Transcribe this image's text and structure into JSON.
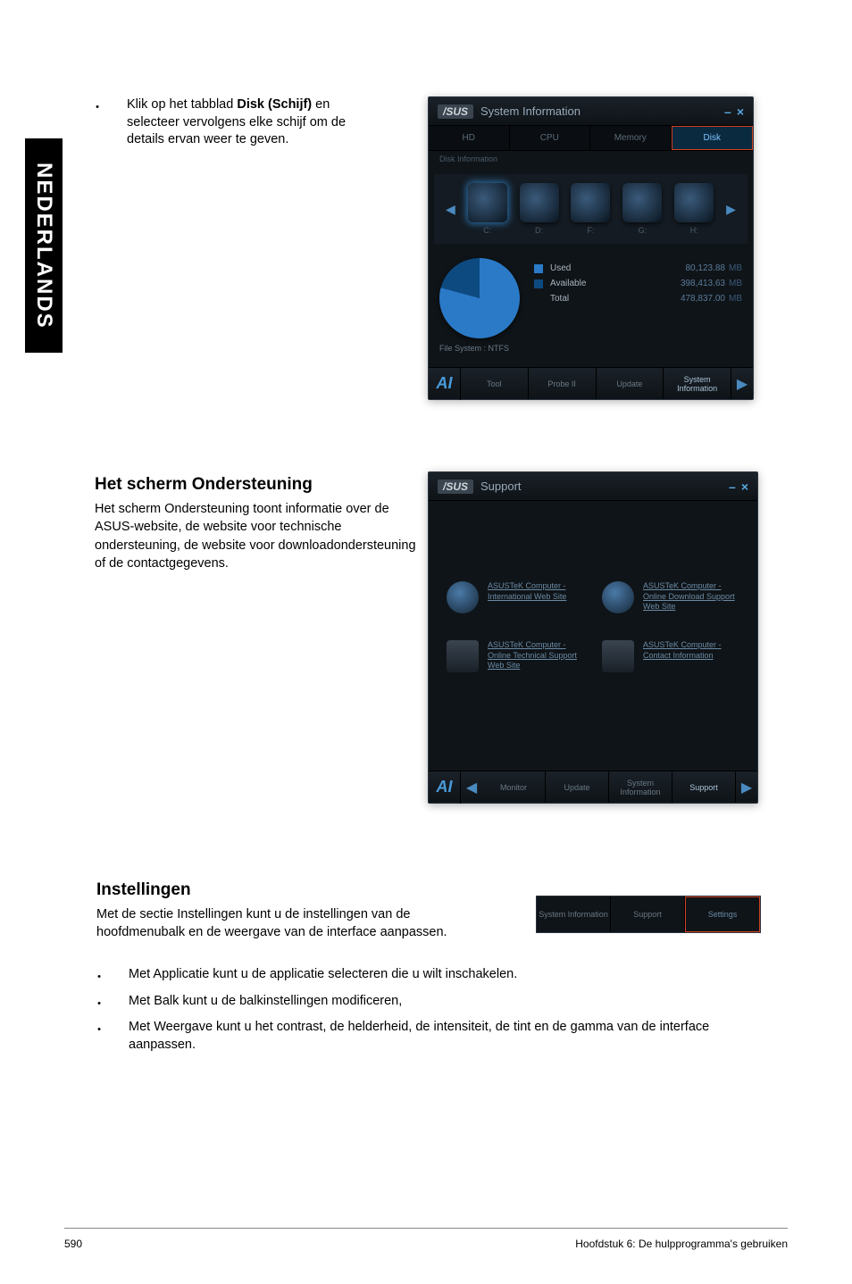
{
  "side_tab": "NEDERLANDS",
  "bullet1": {
    "pre": "Klik op het tabblad ",
    "bold": "Disk (Schijf)",
    "post1": " en selecteer vervolgens elke schijf om de details ervan weer te geven."
  },
  "panel1": {
    "logo": "/SUS",
    "title": "System Information",
    "minus": "–",
    "close": "×",
    "tabs": [
      "HD",
      "CPU",
      "Memory",
      "Disk"
    ],
    "disk_info_label": "Disk Information",
    "drives": [
      "C:",
      "D:",
      "F:",
      "G:",
      "H:"
    ],
    "pie_caption": "File System : NTFS",
    "stats": {
      "used_label": "Used",
      "used_val": "80,123.88",
      "avail_label": "Available",
      "avail_val": "398,413.63",
      "total_label": "Total",
      "total_val": "478,837.00",
      "unit": "MB"
    },
    "footer": [
      "Tool",
      "Probe II",
      "Update",
      "System Information"
    ]
  },
  "sec2": {
    "title": "Het scherm Ondersteuning",
    "para": "Het scherm Ondersteuning toont informatie over de ASUS-website, de website voor technische ondersteuning, de website voor downloadondersteuning of de contactgegevens."
  },
  "panel2": {
    "logo": "/SUS",
    "title": "Support",
    "minus": "–",
    "close": "×",
    "items": [
      {
        "link": "ASUSTeK Computer - International Web Site"
      },
      {
        "link": "ASUSTeK Computer - Online Download Support Web Site"
      },
      {
        "link": "ASUSTeK Computer - Online Technical Support Web Site"
      },
      {
        "link": "ASUSTeK Computer - Contact Information"
      }
    ],
    "footer": [
      "Monitor",
      "Update",
      "System Information",
      "Support"
    ]
  },
  "sec3": {
    "title": "Instellingen",
    "para": "Met de sectie Instellingen kunt u de instellingen van de hoofdmenubalk en de weergave van de interface aanpassen."
  },
  "settings_strip": [
    "System Information",
    "Support",
    "Settings"
  ],
  "bullets3": [
    "Met Applicatie kunt u de applicatie selecteren die u wilt inschakelen.",
    "Met Balk kunt u de balkinstellingen modificeren,",
    "Met Weergave kunt u het contrast, de helderheid, de intensiteit, de tint en de gamma van de interface aanpassen."
  ],
  "footer": {
    "page": "590",
    "chapter": "Hoofdstuk 6: De hulpprogramma's gebruiken"
  }
}
